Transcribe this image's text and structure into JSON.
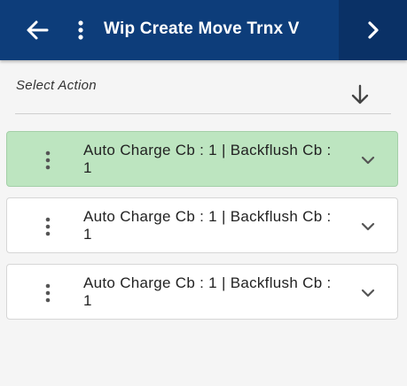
{
  "header": {
    "title": "Wip Create Move Trnx V",
    "back_icon": "arrow-left-icon",
    "menu_icon": "kebab-menu-icon",
    "next_icon": "chevron-right-icon"
  },
  "select_action": {
    "label": "Select Action",
    "icon": "arrow-down-icon"
  },
  "cards": [
    {
      "text": "Auto Charge Cb  : 1 | Backflush Cb  : 1",
      "selected": true
    },
    {
      "text": "Auto Charge Cb  : 1 | Backflush Cb  : 1",
      "selected": false
    },
    {
      "text": "Auto Charge Cb  : 1 | Backflush Cb  : 1",
      "selected": false
    }
  ],
  "colors": {
    "header_bg": "#0d3d7a",
    "next_button_bg": "#0a3166",
    "selected_card_bg": "#bde5c0",
    "page_bg": "#f5f5f5"
  }
}
